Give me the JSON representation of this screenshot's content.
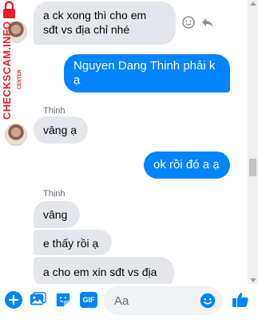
{
  "conversation": {
    "messages": [
      {
        "direction": "in",
        "lines": [
          "a ck xong thì cho em",
          "sđt vs địa chỉ nhé"
        ]
      },
      {
        "direction": "out",
        "lines": [
          "Nguyen Dang Thinh phải k",
          "ạ"
        ]
      },
      {
        "direction": "in",
        "sender": "Thịnh",
        "lines": [
          "vâng ạ"
        ]
      },
      {
        "direction": "out",
        "lines": [
          "ok rồi đó a ạ"
        ]
      },
      {
        "direction": "in",
        "sender": "Thịnh",
        "lines": [
          "vâng"
        ]
      },
      {
        "direction": "in",
        "lines": [
          "e thấy rồi ạ"
        ]
      },
      {
        "direction": "in",
        "lines": [
          "a cho em xin sđt vs địa"
        ]
      }
    ]
  },
  "watermark": {
    "text": "CHECKSCAM.INFO",
    "subtext": "CENTER"
  },
  "composer": {
    "placeholder": "Aa",
    "gif_label": "GIF"
  },
  "colors": {
    "outgoing_bubble": "#0084ff",
    "incoming_bubble": "#e4e6eb",
    "accent": "#0084ff",
    "watermark": "#e8202a"
  },
  "icons": {
    "message_actions": [
      "smiley-icon",
      "reply-icon"
    ],
    "composer": [
      "plus-icon",
      "image-icon",
      "sticker-icon",
      "gif-icon",
      "emoji-icon",
      "thumbs-up-icon"
    ]
  }
}
